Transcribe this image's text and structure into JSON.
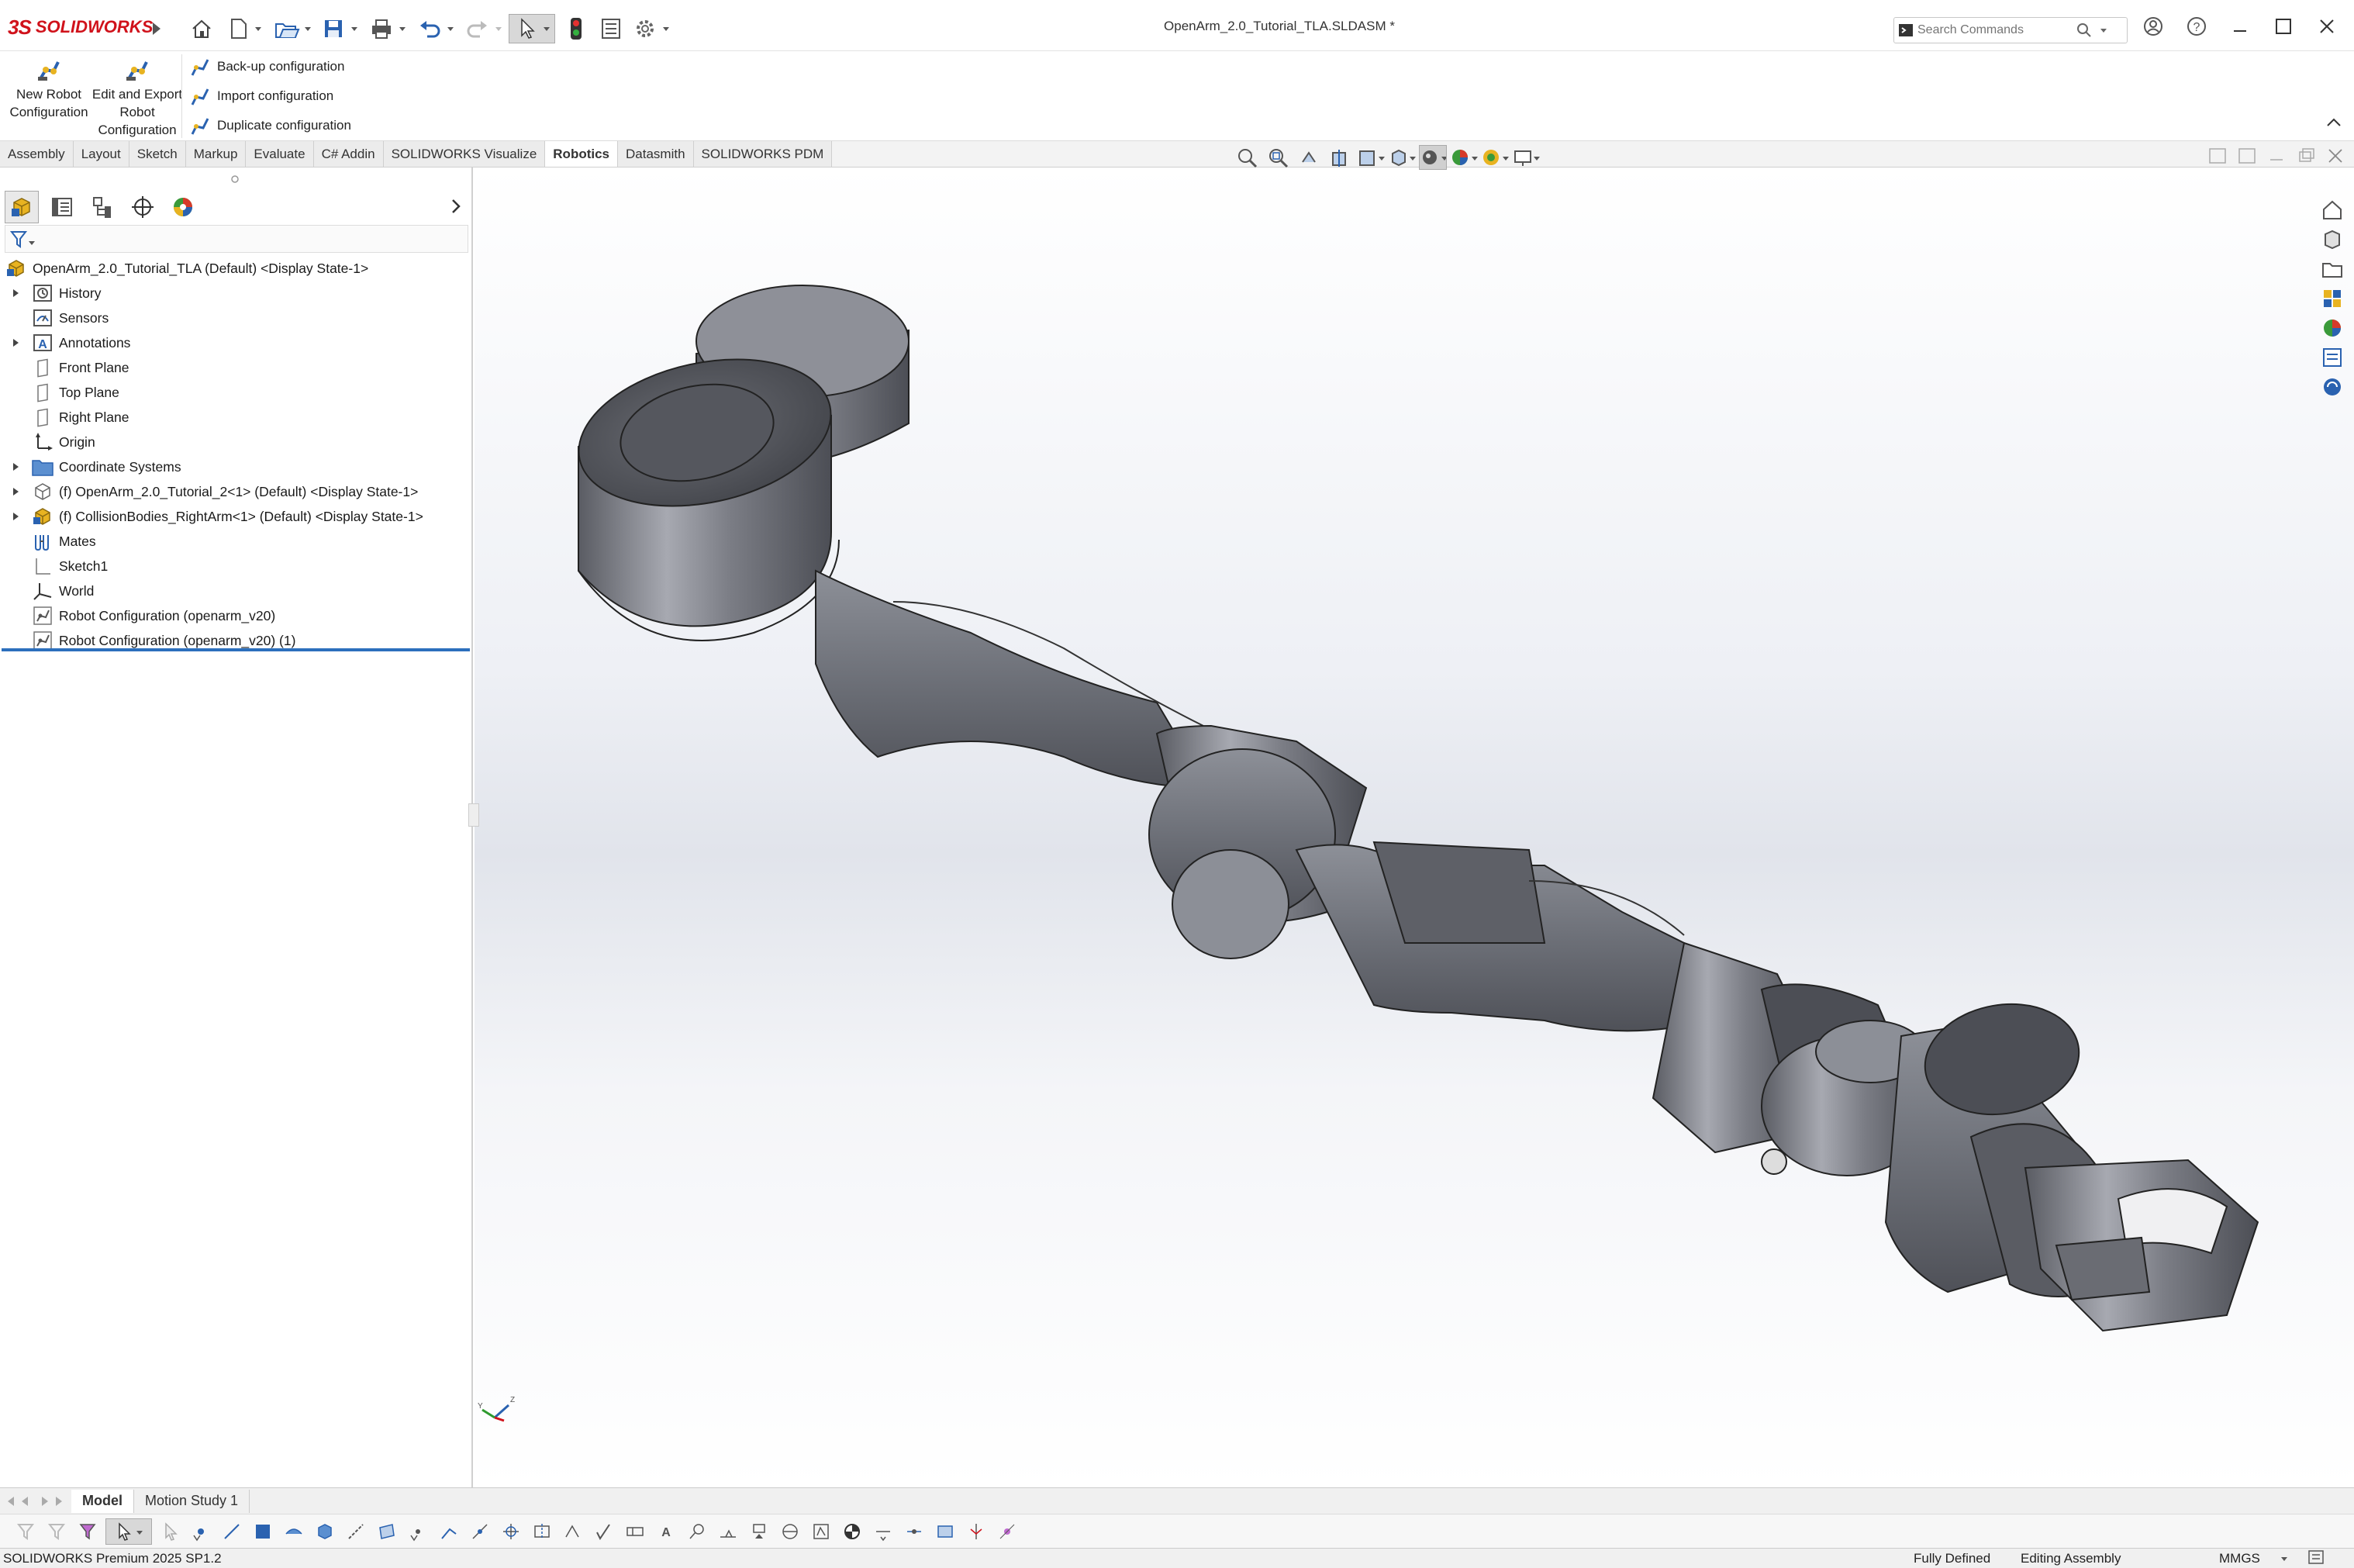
{
  "app": {
    "brand_mark": "3S",
    "brand_name": "SOLIDWORKS",
    "doc_title": "OpenArm_2.0_Tutorial_TLA.SLDASM *"
  },
  "search": {
    "placeholder": "Search Commands"
  },
  "ribbon": {
    "new_robot": "New Robot Configuration",
    "edit_export": "Edit and Export Robot Configuration",
    "backup": "Back-up configuration",
    "import": "Import configuration",
    "duplicate": "Duplicate configuration"
  },
  "tabs": [
    "Assembly",
    "Layout",
    "Sketch",
    "Markup",
    "Evaluate",
    "C# Addin",
    "SOLIDWORKS Visualize",
    "Robotics",
    "Datasmith",
    "SOLIDWORKS PDM"
  ],
  "active_tab": "Robotics",
  "tree": {
    "root": "OpenArm_2.0_Tutorial_TLA  (Default) <Display State-1>",
    "items": [
      {
        "label": "History",
        "icon": "history-icon"
      },
      {
        "label": "Sensors",
        "icon": "sensors-icon"
      },
      {
        "label": "Annotations",
        "icon": "annotations-icon"
      },
      {
        "label": "Front Plane",
        "icon": "plane-icon"
      },
      {
        "label": "Top Plane",
        "icon": "plane-icon"
      },
      {
        "label": "Right Plane",
        "icon": "plane-icon"
      },
      {
        "label": "Origin",
        "icon": "origin-icon"
      },
      {
        "label": "Coordinate Systems",
        "icon": "folder-icon"
      },
      {
        "label": "(f) OpenArm_2.0_Tutorial_2<1> (Default) <Display State-1>",
        "icon": "subassembly-icon"
      },
      {
        "label": "(f) CollisionBodies_RightArm<1> (Default) <Display State-1>",
        "icon": "assembly-icon"
      },
      {
        "label": "Mates",
        "icon": "mates-icon"
      },
      {
        "label": "Sketch1",
        "icon": "sketch-icon"
      },
      {
        "label": "World",
        "icon": "triad-icon"
      },
      {
        "label": "Robot Configuration (openarm_v20)",
        "icon": "robot-config-icon"
      },
      {
        "label": "Robot Configuration (openarm_v20) (1)",
        "icon": "robot-config-icon"
      }
    ]
  },
  "motion_tabs": [
    "Model",
    "Motion Study 1"
  ],
  "active_motion_tab": "Model",
  "status": {
    "product": "SOLIDWORKS Premium 2025 SP1.2",
    "defined": "Fully Defined",
    "mode": "Editing Assembly",
    "units": "MMGS"
  },
  "colors": {
    "brand": "#d0121b",
    "selection_underline": "#2c6fbd",
    "model_gray": "#6f7178"
  }
}
